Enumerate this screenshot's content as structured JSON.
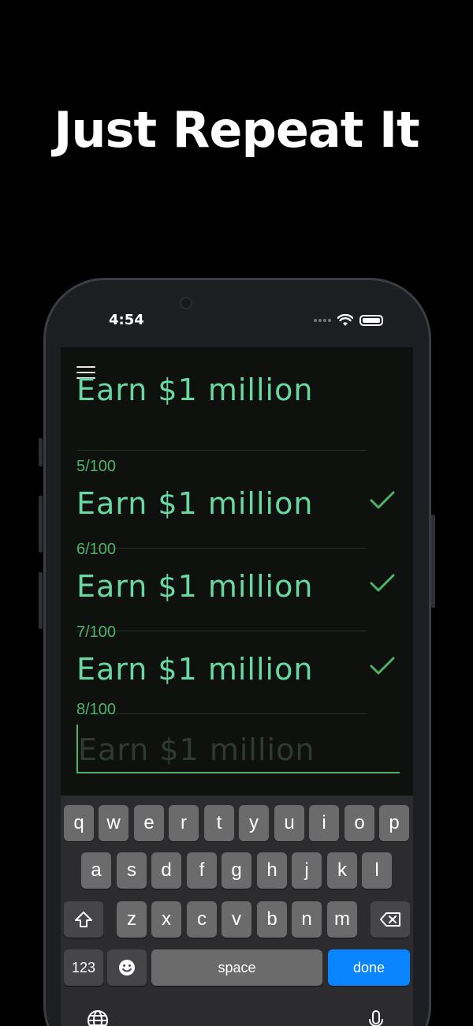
{
  "headline": "Just Repeat It",
  "status_bar": {
    "time": "4:54"
  },
  "colors": {
    "accent": "#4fb36a",
    "goal_text": "#6ad7a2",
    "background": "#0e110e",
    "done_key": "#0a84ff"
  },
  "top_partial_goal": "Earn $1 million",
  "entries": [
    {
      "count": "5/100",
      "goal": "Earn $1 million",
      "completed": true
    },
    {
      "count": "6/100",
      "goal": "Earn $1 million",
      "completed": true
    },
    {
      "count": "7/100",
      "goal": "Earn $1 million",
      "completed": true
    }
  ],
  "input": {
    "count": "8/100",
    "placeholder": "Earn $1 million"
  },
  "keyboard": {
    "row1": [
      "q",
      "w",
      "e",
      "r",
      "t",
      "y",
      "u",
      "i",
      "o",
      "p"
    ],
    "row2": [
      "a",
      "s",
      "d",
      "f",
      "g",
      "h",
      "j",
      "k",
      "l"
    ],
    "row3": [
      "z",
      "x",
      "c",
      "v",
      "b",
      "n",
      "m"
    ],
    "numbers_key": "123",
    "space_key": "space",
    "done_key": "done"
  }
}
